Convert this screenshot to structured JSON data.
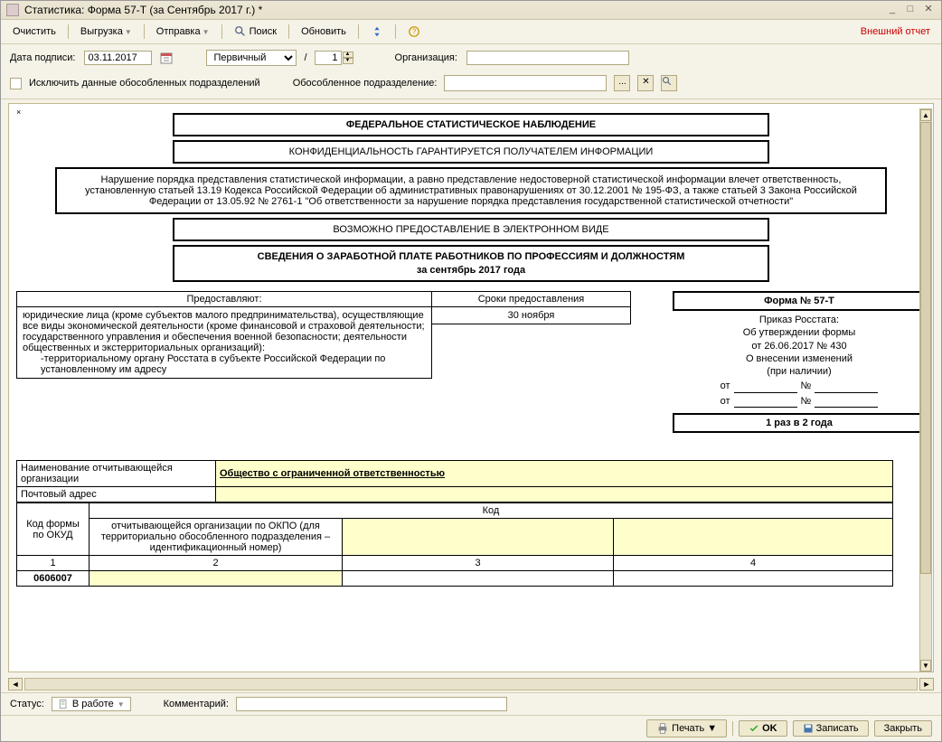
{
  "window": {
    "title": "Статистика: Форма 57-Т (за Сентябрь 2017 г.) *"
  },
  "toolbar": {
    "clear": "Очистить",
    "export": "Выгрузка",
    "send": "Отправка",
    "search": "Поиск",
    "refresh": "Обновить",
    "external_report": "Внешний отчет"
  },
  "filters": {
    "sign_date_label": "Дата подписи:",
    "sign_date": "03.11.2017",
    "report_type": "Первичный",
    "corr_num": "1",
    "org_label": "Организация:",
    "exclude_label": "Исключить данные обособленных подразделений",
    "subdiv_label": "Обособленное подразделение:"
  },
  "doc": {
    "header1": "ФЕДЕРАЛЬНОЕ СТАТИСТИЧЕСКОЕ НАБЛЮДЕНИЕ",
    "header2": "КОНФИДЕНЦИАЛЬНОСТЬ ГАРАНТИРУЕТСЯ ПОЛУЧАТЕЛЕМ ИНФОРМАЦИИ",
    "warning": "Нарушение порядка представления статистической информации, а равно представление недостоверной статистической информации влечет ответственность, установленную статьей 13.19 Кодекса Российской Федерации об административных правонарушениях от 30.12.2001 № 195-ФЗ, а также статьей 3 Закона Российской Федерации от 13.05.92 № 2761-1 \"Об ответственности за нарушение порядка представления государственной статистической отчетности\"",
    "header4": "ВОЗМОЖНО ПРЕДОСТАВЛЕНИЕ В ЭЛЕКТРОННОМ ВИДЕ",
    "header5a": "СВЕДЕНИЯ О ЗАРАБОТНОЙ ПЛАТЕ РАБОТНИКОВ ПО ПРОФЕССИЯМ И ДОЛЖНОСТЯМ",
    "header5b": "за сентябрь 2017 года",
    "col_provide": "Предоставляют:",
    "col_deadline": "Сроки предоставления",
    "provide_text": "юридические лица (кроме субъектов малого предпринимательства), осуществляющие все виды экономической деятельности (кроме финансовой и страховой деятельности; государственного управления и обеспечения военной безопасности; деятельности общественных и экстерриториальных организаций):",
    "provide_text2": "-территориальному органу Росстата в субъекте Российской Федерации по установленному им адресу",
    "deadline_text": "30 ноября",
    "form_no": "Форма № 57-Т",
    "order1": "Приказ Росстата:",
    "order2": "Об утверждении формы",
    "order3": "от 26.06.2017 № 430",
    "order4": "О внесении изменений",
    "order5": "(при наличии)",
    "of_label": "от",
    "num_label": "№",
    "frequency": "1 раз в 2 года",
    "org_name_label": "Наименование отчитывающейся организации",
    "org_name_value": "Общество с ограниченной ответственностью",
    "addr_label": "Почтовый адрес",
    "code_header": "Код",
    "okud_label": "Код формы по ОКУД",
    "okpo_label": "отчитывающейся организации по ОКПО (для территориально обособленного подразделения – идентификационный номер)",
    "row_1": "1",
    "row_2": "2",
    "row_3": "3",
    "row_4": "4",
    "okud_code": "0606007"
  },
  "status": {
    "label": "Статус:",
    "value": "В работе",
    "comment_label": "Комментарий:"
  },
  "footer": {
    "print": "Печать",
    "ok": "OK",
    "save": "Записать",
    "close": "Закрыть"
  }
}
